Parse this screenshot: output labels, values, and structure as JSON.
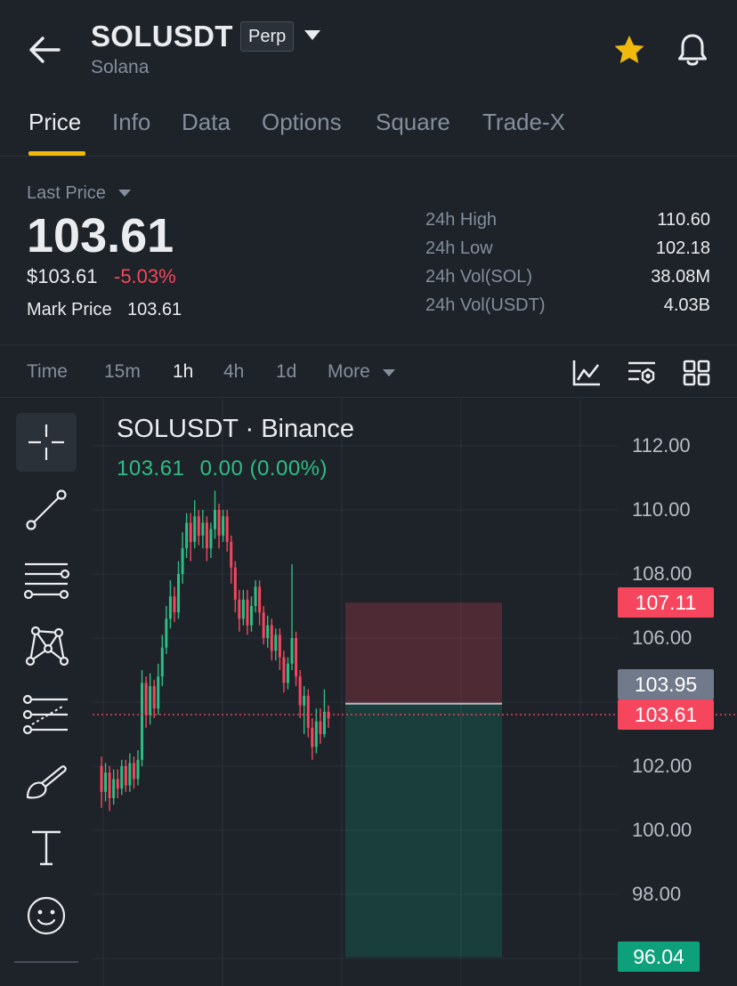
{
  "header": {
    "symbol": "SOLUSDT",
    "badge": "Perp",
    "subtitle": "Solana"
  },
  "tabs": [
    {
      "label": "Price",
      "active": true
    },
    {
      "label": "Info",
      "active": false
    },
    {
      "label": "Data",
      "active": false
    },
    {
      "label": "Options",
      "active": false
    },
    {
      "label": "Square",
      "active": false
    },
    {
      "label": "Trade-X",
      "active": false
    }
  ],
  "price": {
    "last_price_label": "Last Price",
    "last_price": "103.61",
    "usd_price": "$103.61",
    "change_pct": "-5.03%",
    "mark_price_label": "Mark Price",
    "mark_price": "103.61"
  },
  "stats": [
    {
      "label": "24h High",
      "value": "110.60"
    },
    {
      "label": "24h Low",
      "value": "102.18"
    },
    {
      "label": "24h Vol(SOL)",
      "value": "38.08M"
    },
    {
      "label": "24h Vol(USDT)",
      "value": "4.03B"
    }
  ],
  "intervals": {
    "time": "Time",
    "items": [
      "15m",
      "1h",
      "4h",
      "1d"
    ],
    "active": "1h",
    "more": "More"
  },
  "chart": {
    "title": "SOLUSDT · Binance",
    "ohlc_price": "103.61",
    "ohlc_change": "0.00 (0.00%)",
    "y_axis": [
      "112.00",
      "110.00",
      "108.00",
      "106.00",
      "102.00",
      "100.00",
      "98.00"
    ],
    "tags": {
      "stop": "107.11",
      "entry": "103.95",
      "current": "103.61",
      "target": "96.04"
    }
  },
  "colors": {
    "background": "#1e2329",
    "up": "#2ebd85",
    "down": "#f6465d",
    "accent": "#f0b90b",
    "muted": "#848e9c"
  },
  "chart_data": {
    "type": "candlestick",
    "y_range": [
      95.5,
      114.0
    ],
    "current_price": 103.61,
    "position": {
      "entry": 103.95,
      "stop": 107.11,
      "target": 96.04
    },
    "candles": [
      [
        102.0,
        101.2,
        102.3,
        100.7
      ],
      [
        101.2,
        101.8,
        102.1,
        100.9
      ],
      [
        101.8,
        101.0,
        102.0,
        100.6
      ],
      [
        101.0,
        101.6,
        101.9,
        100.8
      ],
      [
        101.6,
        101.3,
        101.9,
        101.0
      ],
      [
        101.3,
        102.0,
        102.2,
        101.1
      ],
      [
        102.0,
        101.4,
        102.2,
        101.2
      ],
      [
        101.4,
        102.1,
        102.4,
        101.2
      ],
      [
        102.1,
        101.6,
        102.3,
        101.3
      ],
      [
        101.6,
        102.2,
        102.5,
        101.4
      ],
      [
        102.2,
        104.6,
        105.0,
        102.0
      ],
      [
        104.6,
        103.6,
        104.8,
        103.2
      ],
      [
        103.6,
        104.5,
        104.9,
        103.3
      ],
      [
        104.5,
        103.8,
        104.7,
        103.5
      ],
      [
        103.8,
        104.8,
        105.2,
        103.6
      ],
      [
        104.8,
        105.7,
        106.1,
        104.5
      ],
      [
        105.7,
        106.6,
        107.0,
        105.5
      ],
      [
        106.6,
        107.3,
        107.8,
        106.3
      ],
      [
        107.3,
        106.8,
        107.6,
        106.5
      ],
      [
        106.8,
        108.0,
        108.4,
        106.6
      ],
      [
        108.0,
        108.8,
        109.3,
        107.7
      ],
      [
        108.8,
        109.6,
        109.9,
        108.5
      ],
      [
        109.6,
        109.0,
        109.9,
        108.4
      ],
      [
        109.0,
        109.8,
        110.3,
        108.8
      ],
      [
        109.8,
        109.2,
        110.0,
        108.9
      ],
      [
        109.2,
        109.6,
        110.0,
        108.8
      ],
      [
        109.6,
        108.8,
        109.8,
        108.4
      ],
      [
        108.8,
        109.4,
        109.6,
        108.5
      ],
      [
        109.4,
        110.0,
        110.6,
        109.1
      ],
      [
        110.0,
        109.2,
        110.2,
        108.8
      ],
      [
        109.2,
        109.8,
        110.0,
        109.0
      ],
      [
        109.8,
        109.0,
        110.0,
        108.7
      ],
      [
        109.0,
        108.2,
        109.2,
        107.7
      ],
      [
        108.2,
        107.2,
        108.4,
        106.8
      ],
      [
        107.2,
        106.6,
        107.5,
        106.2
      ],
      [
        106.6,
        107.2,
        107.5,
        106.4
      ],
      [
        107.2,
        106.4,
        107.5,
        106.1
      ],
      [
        106.4,
        107.0,
        107.3,
        106.2
      ],
      [
        107.0,
        107.6,
        107.8,
        106.8
      ],
      [
        107.6,
        106.8,
        107.8,
        106.4
      ],
      [
        106.8,
        106.0,
        107.0,
        105.8
      ],
      [
        106.0,
        106.4,
        106.7,
        105.7
      ],
      [
        106.4,
        105.6,
        106.6,
        105.3
      ],
      [
        105.6,
        106.1,
        106.3,
        105.3
      ],
      [
        106.1,
        105.4,
        106.3,
        105.0
      ],
      [
        105.4,
        104.6,
        105.6,
        104.3
      ],
      [
        104.6,
        105.2,
        105.4,
        104.4
      ],
      [
        105.2,
        106.0,
        108.3,
        105.0
      ],
      [
        106.0,
        104.8,
        106.2,
        104.5
      ],
      [
        104.8,
        103.9,
        105.0,
        103.5
      ],
      [
        103.9,
        104.2,
        104.5,
        103.0
      ],
      [
        104.2,
        103.2,
        104.4,
        102.9
      ],
      [
        103.2,
        102.6,
        103.5,
        102.2
      ],
      [
        102.6,
        103.4,
        103.8,
        102.4
      ],
      [
        103.4,
        103.0,
        103.8,
        102.7
      ],
      [
        103.0,
        103.7,
        104.4,
        102.9
      ],
      [
        103.7,
        103.5,
        103.9,
        103.2
      ]
    ]
  }
}
